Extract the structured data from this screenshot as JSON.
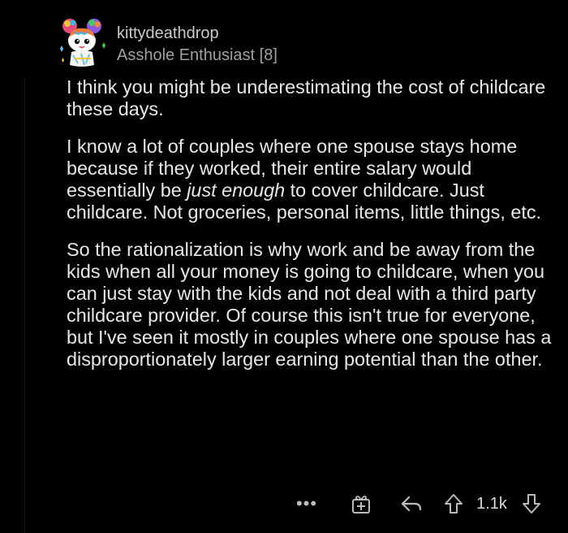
{
  "comment": {
    "author": {
      "username": "kittydeathdrop",
      "flair": "Asshole Enthusiast [8]",
      "avatar_icon": "snoo-avatar-icon"
    },
    "paragraphs": {
      "p1": "I think you might be underestimating the cost of childcare these days.",
      "p2_before": "I know a lot of couples where one spouse stays home because if they worked, their entire salary would essentially be ",
      "p2_emphasis": "just enough",
      "p2_after": " to cover childcare. Just childcare. Not groceries, personal items, little things, etc.",
      "p3": "So the rationalization is why work and be away from the kids when all your money is going to childcare, when you can just stay with the kids and not deal with a third party childcare provider. Of course this isn't true for everyone, but I've seen it mostly in couples where one spouse has a disproportionately larger earning potential than the other."
    },
    "actions": {
      "more_label": "•••",
      "score": "1.1k",
      "icons": {
        "more": "more-options-icon",
        "award": "award-icon",
        "reply": "reply-icon",
        "upvote": "upvote-icon",
        "downvote": "downvote-icon"
      }
    }
  },
  "colors": {
    "background": "#000000",
    "text": "#e6e8ea",
    "muted": "#9ea1a4",
    "icon": "#b9bcbf"
  }
}
